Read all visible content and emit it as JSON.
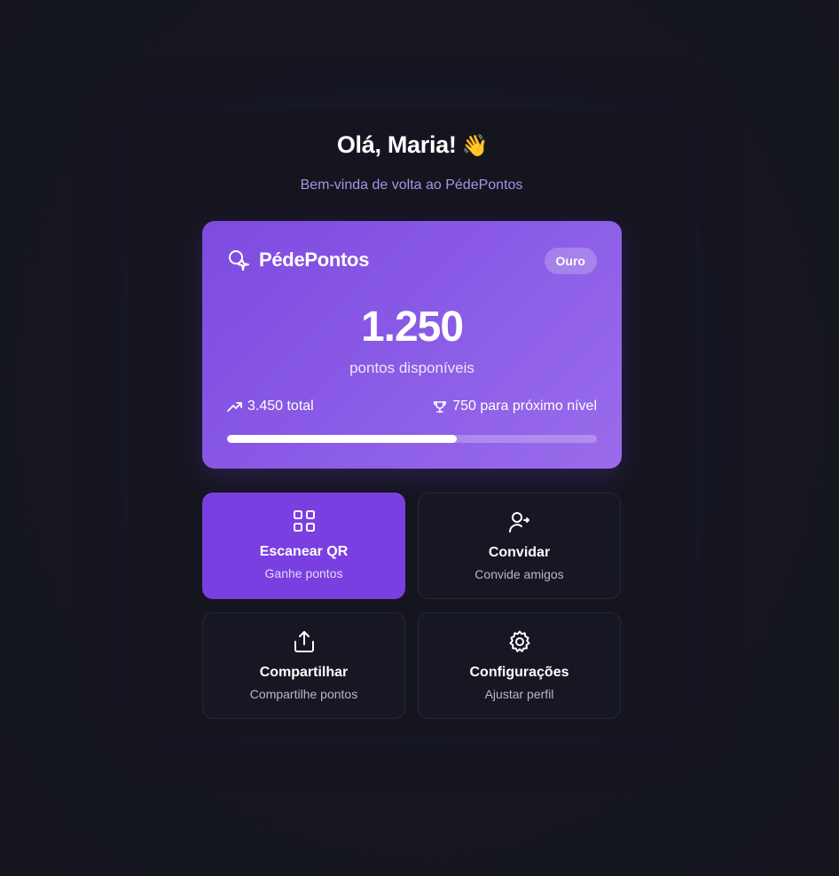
{
  "header": {
    "greeting": "Olá, Maria!",
    "greeting_emoji": "👋",
    "subtitle": "Bem-vinda de volta ao PédePontos"
  },
  "points_card": {
    "brand_name": "PédePontos",
    "brand_icon": "sparkle-magnifier-icon",
    "tier": "Ouro",
    "points_value": "1.250",
    "points_label": "pontos disponíveis",
    "total_label": "3.450 total",
    "total_icon": "trending-up-icon",
    "next_level_label": "750 para próximo nível",
    "next_level_icon": "trophy-icon",
    "progress_fraction": 0.62
  },
  "actions": [
    {
      "title": "Escanear QR",
      "subtitle": "Ganhe pontos",
      "icon": "scan-qr-icon"
    },
    {
      "title": "Convidar",
      "subtitle": "Convide amigos",
      "icon": "invite-user-icon"
    },
    {
      "title": "Compartilhar",
      "subtitle": "Compartilhe pontos",
      "icon": "share-icon"
    },
    {
      "title": "Configurações",
      "subtitle": "Ajustar perfil",
      "icon": "gear-icon"
    }
  ],
  "colors": {
    "background": "#15161f",
    "accent": "#7a3fe0",
    "card_gradient_start": "#7e4ae0",
    "card_gradient_end": "#9a6ceb",
    "subtitle": "#a594e6"
  }
}
